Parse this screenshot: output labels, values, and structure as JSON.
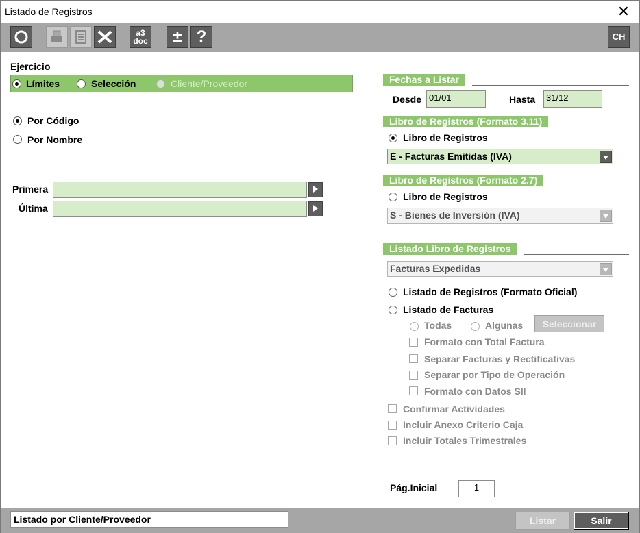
{
  "window": {
    "title": "Listado de Registros",
    "close_glyph": "✕"
  },
  "toolbar": {
    "refresh_icon": "refresh-icon",
    "print_icon": "print-icon",
    "preview_icon": "preview-icon",
    "excel_icon": "excel-icon",
    "a3doc_top": "a3",
    "a3doc_bottom": "doc",
    "plusminus": "±",
    "help": "?",
    "lang": "CH"
  },
  "left": {
    "ejercicio_label": "Ejercicio",
    "options": {
      "limites": "Límites",
      "seleccion": "Selección",
      "cliente": "Cliente/Proveedor"
    },
    "order": {
      "codigo": "Por Código",
      "nombre": "Por Nombre"
    },
    "primera_label": "Primera",
    "ultima_label": "Última",
    "primera_value": "",
    "ultima_value": ""
  },
  "fechas": {
    "header": "Fechas a Listar",
    "desde_label": "Desde",
    "desde_value": "01/01",
    "hasta_label": "Hasta",
    "hasta_value": "31/12"
  },
  "libro311": {
    "header": "Libro de Registros (Formato 3.11)",
    "radio_label": "Libro de Registros",
    "select_value": "E - Facturas Emitidas (IVA)"
  },
  "libro27": {
    "header": "Libro de Registros (Formato 2.7)",
    "radio_label": "Libro de Registros",
    "select_value": "S - Bienes de Inversión (IVA)"
  },
  "listado": {
    "header": "Listado Libro de Registros",
    "select_value": "Facturas Expedidas",
    "opt_oficial": "Listado de Registros (Formato Oficial)",
    "opt_facturas": "Listado de Facturas",
    "todas": "Todas",
    "algunas": "Algunas",
    "seleccionar": "Seleccionar",
    "chk_total": "Formato con Total Factura",
    "chk_separar": "Separar Facturas y Rectificativas",
    "chk_tipo": "Separar por Tipo de Operación",
    "chk_sii": "Formato con Datos SII",
    "chk_actividades": "Confirmar Actividades",
    "chk_anexo": "Incluir Anexo Criterio Caja",
    "chk_trimestrales": "Incluir Totales Trimestrales",
    "pag_label": "Pág.Inicial",
    "pag_value": "1"
  },
  "footer": {
    "status": "Listado por Cliente/Proveedor",
    "listar": "Listar",
    "salir": "Salir"
  }
}
